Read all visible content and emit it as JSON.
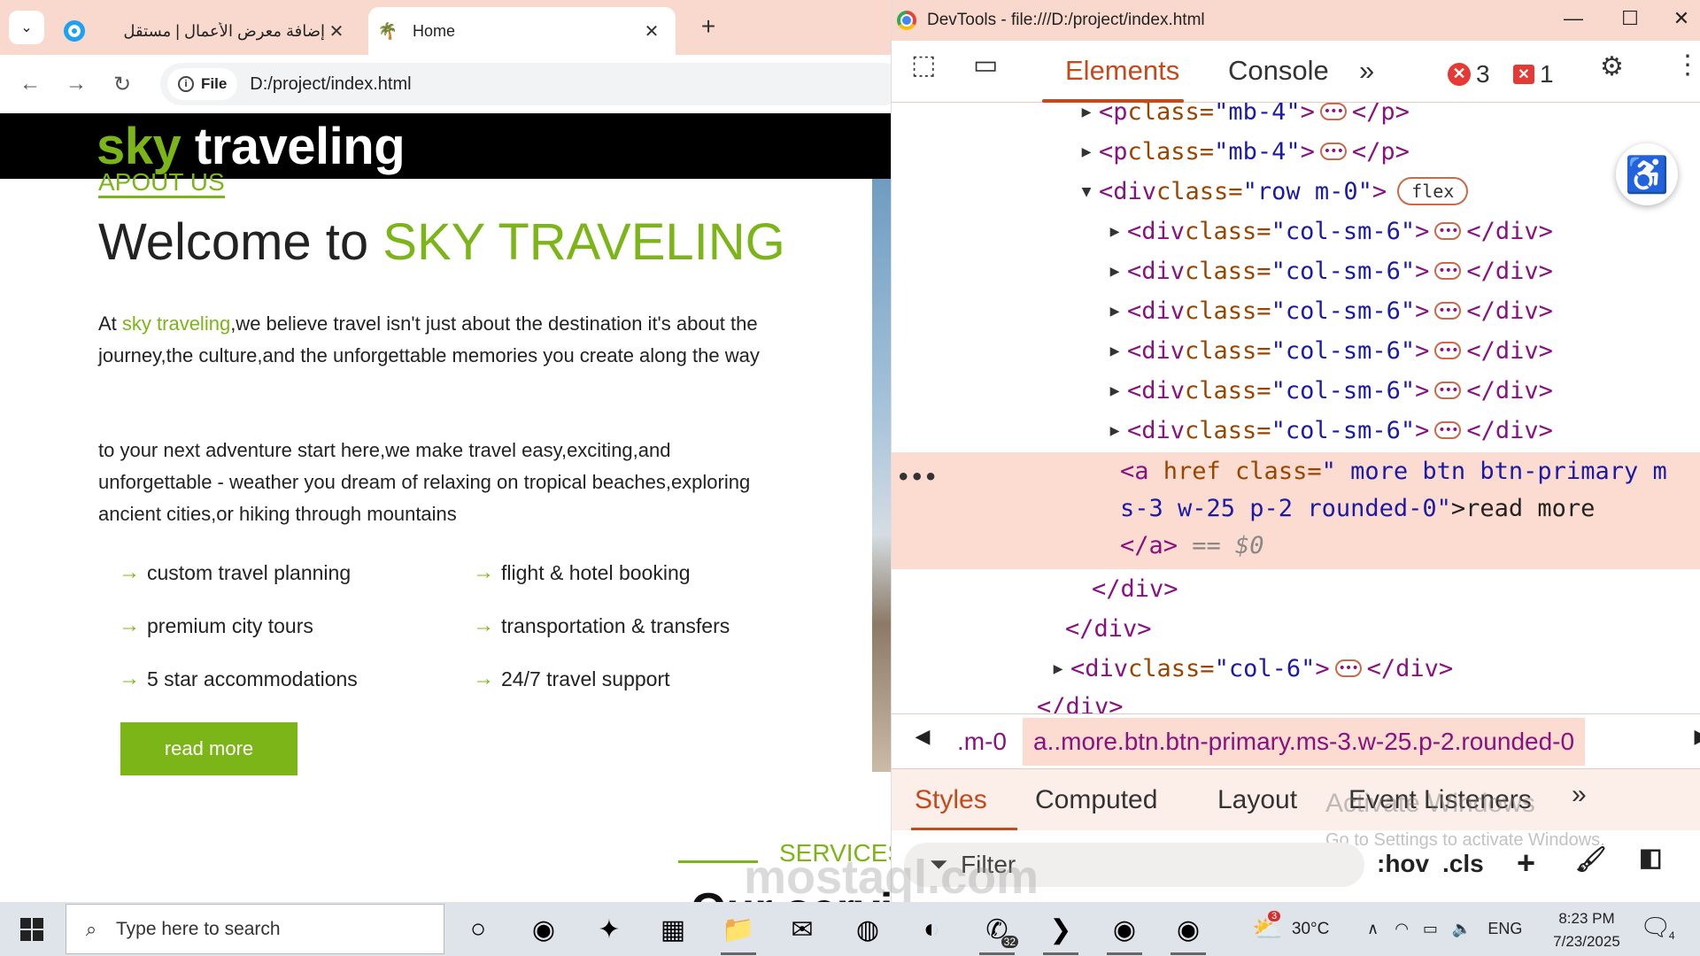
{
  "browser": {
    "tabs": [
      {
        "title": "إضافة معرض الأعمال | مستقل",
        "close": "✕"
      },
      {
        "title": "Home",
        "close": "✕"
      }
    ],
    "new_tab": "+",
    "nav": {
      "back": "←",
      "forward": "→",
      "reload": "↻"
    },
    "security_chip": "File",
    "url": "D:/project/index.html"
  },
  "site": {
    "brand_accent": "sky",
    "brand_rest": " traveling",
    "about_label": "APOUT US",
    "welcome_prefix": "Welcome to ",
    "welcome_accent": "SKY TRAVELING",
    "para1_prefix": "At ",
    "para1_accent": "sky traveling",
    "para1_rest": ",we believe travel isn't just about the destination it's about the journey,the culture,and the unforgettable memories you create along the way",
    "para2": "to your next adventure start here,we make travel easy,exciting,and unforgettable - weather you dream of relaxing on tropical beaches,exploring ancient cities,or hiking through mountains",
    "features": [
      {
        "arrow": "→",
        "label": " custom travel planning"
      },
      {
        "arrow": "→",
        "label": "flight & hotel booking"
      },
      {
        "arrow": "→",
        "label": "premium city tours"
      },
      {
        "arrow": "→",
        "label": " transportation & transfers"
      },
      {
        "arrow": "→",
        "label": "5 star accommodations"
      },
      {
        "arrow": "→",
        "label": "24/7 travel support"
      }
    ],
    "read_more": "read more",
    "services_label": "SERVICES",
    "partial_heading": "Our services"
  },
  "devtools": {
    "title": "DevTools - file:///D:/project/index.html",
    "window_controls": {
      "minimize": "—",
      "maximize": "☐",
      "close": "✕"
    },
    "tabs": {
      "elements": "Elements",
      "console": "Console",
      "more": "»"
    },
    "errors": {
      "icon": "✕",
      "count": "3"
    },
    "issues": {
      "icon": "✕",
      "count": "1"
    },
    "dom_lines": [
      {
        "open": "<p",
        "attr": " class=",
        "val": "\"mb-4\"",
        "close_tag": "</p>"
      },
      {
        "open": "<p",
        "attr": " class=",
        "val": "\"mb-4\"",
        "close_tag": "</p>"
      },
      {
        "open": "<div",
        "attr": " class=",
        "val": "\"row m-0\"",
        "badge": "flex"
      },
      {
        "open": "<div",
        "attr": " class=",
        "val": "\"col-sm-6\"",
        "close_tag": "</div>"
      },
      {
        "open": "<div",
        "attr": " class=",
        "val": "\"col-sm-6\"",
        "close_tag": "</div>"
      },
      {
        "open": "<div",
        "attr": " class=",
        "val": "\"col-sm-6\"",
        "close_tag": "</div>"
      },
      {
        "open": "<div",
        "attr": " class=",
        "val": "\"col-sm-6\"",
        "close_tag": "</div>"
      },
      {
        "open": "<div",
        "attr": " class=",
        "val": "\"col-sm-6\"",
        "close_tag": "</div>"
      },
      {
        "open": "<div",
        "attr": " class=",
        "val": "\"col-sm-6\"",
        "close_tag": "</div>"
      }
    ],
    "selected": {
      "dots": "•••",
      "line1_open": "<a",
      "line1_attr": " href class=",
      "line1_val": "\" more btn btn-primary m",
      "line2_val": "s-3 w-25 p-2 rounded-0\"",
      "line2_text": ">read more",
      "line3_tag": "</a>",
      "line3_eq": " == $0"
    },
    "closing_lines": [
      {
        "text": "</div>"
      },
      {
        "text": "</div>"
      }
    ],
    "col6_line": {
      "open": "<div",
      "attr": " class=",
      "val": "\"col-6\"",
      "close_tag": "</div>"
    },
    "partial_line": "</div>",
    "ellipsis": "•••",
    "breadcrumb": {
      "prev": "◀",
      "next": "▶",
      "item1": ".m-0",
      "item2": "a..more.btn.btn-primary.ms-3.w-25.p-2.rounded-0"
    },
    "styles_tabs": [
      "Styles",
      "Computed",
      "Layout",
      "Event Listeners"
    ],
    "styles_more": "»",
    "activate_windows": "Activate Windows",
    "activate_sub": "Go to Settings to activate Windows.",
    "filter_placeholder": "Filter",
    "hov": ":hov",
    "cls": ".cls"
  },
  "taskbar": {
    "search_placeholder": "Type here to search",
    "weather": "30°C",
    "weather_badge": "3",
    "whatsapp_badge": "32",
    "language": "ENG",
    "time": "8:23 PM",
    "date": "7/23/2025",
    "notif_count": "4"
  },
  "watermark": "mostaql.com"
}
